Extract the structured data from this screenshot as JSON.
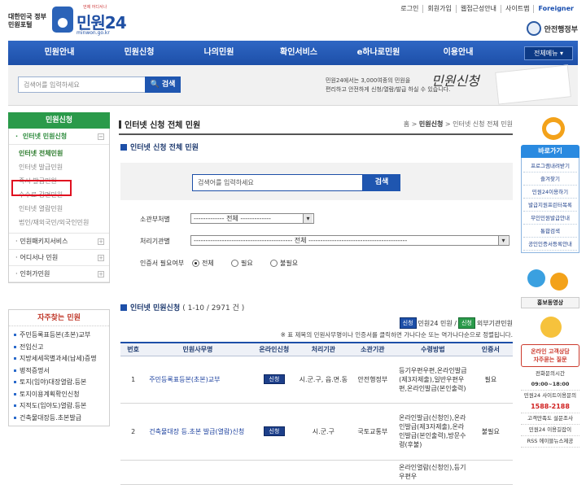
{
  "header": {
    "logo_small": "대한민국 정부민원포털",
    "logo_tag": "언제 어디서나",
    "logo_main": "민원24",
    "logo_url": "minwon.go.kr",
    "top_links": [
      "로그인",
      "회원가입",
      "웹접근성안내",
      "사이트맵",
      "Foreigner"
    ],
    "ministry": "안전행정부"
  },
  "nav": {
    "items": [
      "민원안내",
      "민원신청",
      "나의민원",
      "확인서비스",
      "e하나로민원",
      "이용안내"
    ],
    "all_menu": "전체메뉴 ▾"
  },
  "search_strip": {
    "placeholder": "검색어를 입력하세요",
    "button": "검색",
    "desc_line1": "민원24에서는 3,000여종의 민원을",
    "desc_line2": "편리하고 안전하게 신청/열람/발급 하실 수 있습니다.",
    "art_text": "민원신청"
  },
  "lnb": {
    "title": "민원신청",
    "section_active": "인터넷 민원신청",
    "sub_items": [
      "인터넷 전체민원",
      "인터넷 발급민원",
      "즉시 발급민원",
      "수수료 감면민원",
      "인터넷 열람민원",
      "법인/재외국민/외국인민원"
    ],
    "other_sections": [
      "민원패키지서비스",
      "어디서나 민원",
      "인허가민원"
    ]
  },
  "favorites": {
    "title": "자주찾는 민원",
    "items": [
      "주민등록표등본(초본)교부",
      "전입신고",
      "지방세세목별과세(납세)증명",
      "병적증명서",
      "토지(임야)대장열람.등본",
      "토지이용계획확인신청",
      "지적도(임야도)열람.등본",
      "건축물대장등.초본발급"
    ]
  },
  "main": {
    "page_title": "인터넷 신청 전체 민원",
    "breadcrumb_home": "홈",
    "breadcrumb_1": "민원신청",
    "breadcrumb_2": "인터넷 신청 전체 민원",
    "section1": "인터넷 신청 전체 민원",
    "search_placeholder": "검색어를 입력하세요",
    "search_button": "검색",
    "filter_agency_label": "소관부처별",
    "filter_agency_value": "------------- 전체 -------------",
    "filter_office_label": "처리기관별",
    "filter_office_value": "------------------------------------------ 전체 ------------------------------------------",
    "cert_label": "인증서 필요여부",
    "radio_all": "전체",
    "radio_required": "필요",
    "radio_not_required": "불필요",
    "section2": "인터넷 민원신청",
    "section2_count": "( 1-10 / 2971 건 )",
    "legend_tag1": "신청",
    "legend_text1": "민원24 민원 /",
    "legend_tag2": "신청",
    "legend_text2": "외부기관민원",
    "note": "※ 표 제목의 민원사무명이나 인증서를 클릭하면 가나다순 또는 역가나다순으로 정렬됩니다.",
    "table": {
      "headers": [
        "번호",
        "민원사무명",
        "온라인신청",
        "처리기관",
        "소관기관",
        "수령방법",
        "인증서"
      ],
      "rows": [
        {
          "no": "1",
          "name": "주민등록표등본(초본)교부",
          "apply": "신청",
          "office": "시.군.구, 읍.면.동",
          "agency": "안전행정부",
          "method": "등기우편우편,온라인발급(제3자제출),일반우편우편,온라인발급(본인출력)",
          "cert": "필요"
        },
        {
          "no": "2",
          "name": "건축물대장 등.초본 발급(열람)신청",
          "apply": "신청",
          "office": "시.군.구",
          "agency": "국토교통부",
          "method": "온라인발급(신청인),온라인발급(제3자제출),온라인발급(본인출력),방문수령(후불)",
          "cert": "불필요"
        },
        {
          "no": "",
          "name": "",
          "apply": "",
          "office": "",
          "agency": "",
          "method": "온라인열람(신청인),등기우편우",
          "cert": ""
        }
      ]
    }
  },
  "quick": {
    "title": "바로가기",
    "items": [
      "프로그램내려받기",
      "즐겨찾기",
      "민원24이용하기",
      "발급지원프린터목록",
      "무인민원발급안내",
      "통합검색",
      "공인인증서등록안내"
    ],
    "promo": "홍보동영상",
    "cs_title": "온라인 고객상담",
    "cs_title2": "자주묻는 질문",
    "cs_hours_label": "전화문의시간",
    "cs_hours": "09:00~18:00",
    "cs_site_label": "민원24 사이트이용문의",
    "cs_phone": "1588-2188",
    "cs_survey": "고객만족도 설문조사",
    "cs_guide": "민원24 이용길잡이",
    "cs_rss": "RSS 에이블뉴스제공"
  }
}
